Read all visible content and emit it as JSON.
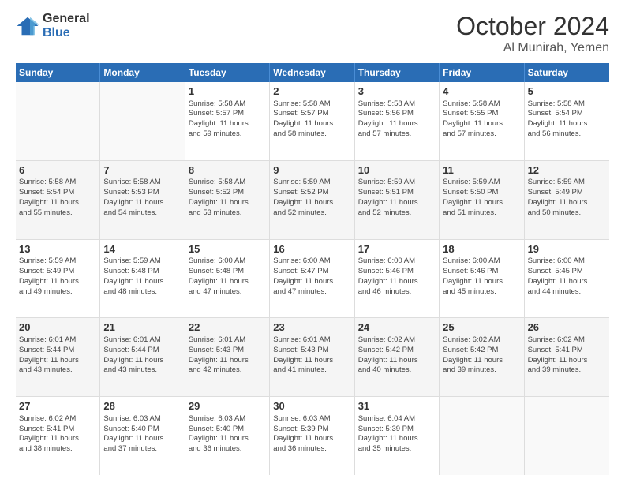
{
  "logo": {
    "line1": "General",
    "line2": "Blue"
  },
  "title": "October 2024",
  "location": "Al Munirah, Yemen",
  "header_days": [
    "Sunday",
    "Monday",
    "Tuesday",
    "Wednesday",
    "Thursday",
    "Friday",
    "Saturday"
  ],
  "weeks": [
    [
      {
        "day": "",
        "info": ""
      },
      {
        "day": "",
        "info": ""
      },
      {
        "day": "1",
        "info": "Sunrise: 5:58 AM\nSunset: 5:57 PM\nDaylight: 11 hours\nand 59 minutes."
      },
      {
        "day": "2",
        "info": "Sunrise: 5:58 AM\nSunset: 5:57 PM\nDaylight: 11 hours\nand 58 minutes."
      },
      {
        "day": "3",
        "info": "Sunrise: 5:58 AM\nSunset: 5:56 PM\nDaylight: 11 hours\nand 57 minutes."
      },
      {
        "day": "4",
        "info": "Sunrise: 5:58 AM\nSunset: 5:55 PM\nDaylight: 11 hours\nand 57 minutes."
      },
      {
        "day": "5",
        "info": "Sunrise: 5:58 AM\nSunset: 5:54 PM\nDaylight: 11 hours\nand 56 minutes."
      }
    ],
    [
      {
        "day": "6",
        "info": "Sunrise: 5:58 AM\nSunset: 5:54 PM\nDaylight: 11 hours\nand 55 minutes."
      },
      {
        "day": "7",
        "info": "Sunrise: 5:58 AM\nSunset: 5:53 PM\nDaylight: 11 hours\nand 54 minutes."
      },
      {
        "day": "8",
        "info": "Sunrise: 5:58 AM\nSunset: 5:52 PM\nDaylight: 11 hours\nand 53 minutes."
      },
      {
        "day": "9",
        "info": "Sunrise: 5:59 AM\nSunset: 5:52 PM\nDaylight: 11 hours\nand 52 minutes."
      },
      {
        "day": "10",
        "info": "Sunrise: 5:59 AM\nSunset: 5:51 PM\nDaylight: 11 hours\nand 52 minutes."
      },
      {
        "day": "11",
        "info": "Sunrise: 5:59 AM\nSunset: 5:50 PM\nDaylight: 11 hours\nand 51 minutes."
      },
      {
        "day": "12",
        "info": "Sunrise: 5:59 AM\nSunset: 5:49 PM\nDaylight: 11 hours\nand 50 minutes."
      }
    ],
    [
      {
        "day": "13",
        "info": "Sunrise: 5:59 AM\nSunset: 5:49 PM\nDaylight: 11 hours\nand 49 minutes."
      },
      {
        "day": "14",
        "info": "Sunrise: 5:59 AM\nSunset: 5:48 PM\nDaylight: 11 hours\nand 48 minutes."
      },
      {
        "day": "15",
        "info": "Sunrise: 6:00 AM\nSunset: 5:48 PM\nDaylight: 11 hours\nand 47 minutes."
      },
      {
        "day": "16",
        "info": "Sunrise: 6:00 AM\nSunset: 5:47 PM\nDaylight: 11 hours\nand 47 minutes."
      },
      {
        "day": "17",
        "info": "Sunrise: 6:00 AM\nSunset: 5:46 PM\nDaylight: 11 hours\nand 46 minutes."
      },
      {
        "day": "18",
        "info": "Sunrise: 6:00 AM\nSunset: 5:46 PM\nDaylight: 11 hours\nand 45 minutes."
      },
      {
        "day": "19",
        "info": "Sunrise: 6:00 AM\nSunset: 5:45 PM\nDaylight: 11 hours\nand 44 minutes."
      }
    ],
    [
      {
        "day": "20",
        "info": "Sunrise: 6:01 AM\nSunset: 5:44 PM\nDaylight: 11 hours\nand 43 minutes."
      },
      {
        "day": "21",
        "info": "Sunrise: 6:01 AM\nSunset: 5:44 PM\nDaylight: 11 hours\nand 43 minutes."
      },
      {
        "day": "22",
        "info": "Sunrise: 6:01 AM\nSunset: 5:43 PM\nDaylight: 11 hours\nand 42 minutes."
      },
      {
        "day": "23",
        "info": "Sunrise: 6:01 AM\nSunset: 5:43 PM\nDaylight: 11 hours\nand 41 minutes."
      },
      {
        "day": "24",
        "info": "Sunrise: 6:02 AM\nSunset: 5:42 PM\nDaylight: 11 hours\nand 40 minutes."
      },
      {
        "day": "25",
        "info": "Sunrise: 6:02 AM\nSunset: 5:42 PM\nDaylight: 11 hours\nand 39 minutes."
      },
      {
        "day": "26",
        "info": "Sunrise: 6:02 AM\nSunset: 5:41 PM\nDaylight: 11 hours\nand 39 minutes."
      }
    ],
    [
      {
        "day": "27",
        "info": "Sunrise: 6:02 AM\nSunset: 5:41 PM\nDaylight: 11 hours\nand 38 minutes."
      },
      {
        "day": "28",
        "info": "Sunrise: 6:03 AM\nSunset: 5:40 PM\nDaylight: 11 hours\nand 37 minutes."
      },
      {
        "day": "29",
        "info": "Sunrise: 6:03 AM\nSunset: 5:40 PM\nDaylight: 11 hours\nand 36 minutes."
      },
      {
        "day": "30",
        "info": "Sunrise: 6:03 AM\nSunset: 5:39 PM\nDaylight: 11 hours\nand 36 minutes."
      },
      {
        "day": "31",
        "info": "Sunrise: 6:04 AM\nSunset: 5:39 PM\nDaylight: 11 hours\nand 35 minutes."
      },
      {
        "day": "",
        "info": ""
      },
      {
        "day": "",
        "info": ""
      }
    ]
  ]
}
